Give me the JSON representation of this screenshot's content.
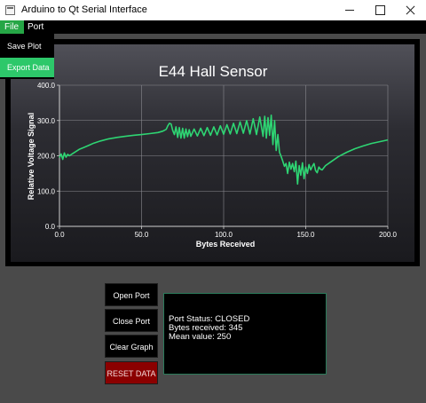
{
  "window": {
    "title": "Arduino to Qt Serial Interface",
    "icon": "app-window-icon"
  },
  "menubar": {
    "file": "File",
    "port": "Port"
  },
  "file_menu": {
    "save": "Save Plot",
    "export": "Export Data"
  },
  "controls": {
    "open": "Open Port",
    "close": "Close Port",
    "clear": "Clear Graph",
    "reset": "RESET DATA"
  },
  "status": {
    "port": "Port Status: CLOSED",
    "bytes": "Bytes received: 345",
    "mean": "Mean value: 250"
  },
  "colors": {
    "accent": "#26a646",
    "line": "#2ed573",
    "reset": "#8b0000"
  },
  "chart_data": {
    "type": "line",
    "title": "E44 Hall Sensor",
    "xlabel": "Bytes Received",
    "ylabel": "Relative Voltage Signal",
    "xlim": [
      0,
      200
    ],
    "ylim": [
      0,
      400
    ],
    "xticks": [
      "0.0",
      "50.0",
      "100.0",
      "150.0",
      "200.0"
    ],
    "yticks": [
      "0.0",
      "100.0",
      "200.0",
      "300.0",
      "400.0"
    ],
    "grid": true,
    "series": [
      {
        "x": [
          0,
          1,
          2,
          3,
          4,
          5,
          6,
          8,
          10,
          12,
          15,
          18,
          21,
          25,
          30,
          35,
          40,
          45,
          50,
          55,
          60,
          63,
          65,
          66,
          67,
          68,
          69,
          70,
          71,
          72,
          73,
          74,
          75,
          76,
          77,
          78,
          79,
          80,
          82,
          84,
          86,
          88,
          90,
          92,
          94,
          96,
          98,
          100,
          102,
          104,
          106,
          108,
          110,
          112,
          114,
          116,
          118,
          120,
          122,
          124,
          125,
          126,
          127,
          128,
          129,
          130,
          131,
          132,
          133,
          134,
          135,
          136,
          137,
          138,
          139,
          140,
          141,
          142,
          143,
          144,
          145,
          146,
          147,
          148,
          149,
          150,
          151,
          152,
          153,
          154,
          155,
          156,
          157,
          158,
          159,
          160,
          162,
          165,
          170,
          175,
          180,
          185,
          190,
          195,
          200
        ],
        "y": [
          195,
          205,
          190,
          208,
          196,
          204,
          200,
          206,
          212,
          218,
          224,
          230,
          236,
          242,
          248,
          252,
          255,
          258,
          260,
          263,
          266,
          270,
          275,
          285,
          292,
          290,
          272,
          260,
          282,
          252,
          280,
          250,
          278,
          250,
          276,
          254,
          274,
          255,
          276,
          256,
          278,
          257,
          280,
          258,
          282,
          259,
          285,
          261,
          288,
          262,
          292,
          263,
          296,
          264,
          300,
          262,
          305,
          260,
          310,
          255,
          312,
          250,
          308,
          258,
          315,
          232,
          300,
          215,
          260,
          210,
          198,
          185,
          170,
          178,
          150,
          182,
          162,
          178,
          155,
          185,
          120,
          172,
          145,
          180,
          135,
          168,
          150,
          175,
          160,
          170,
          178,
          158,
          152,
          168,
          162,
          160,
          172,
          182,
          198,
          210,
          220,
          228,
          235,
          240,
          245
        ]
      }
    ]
  }
}
